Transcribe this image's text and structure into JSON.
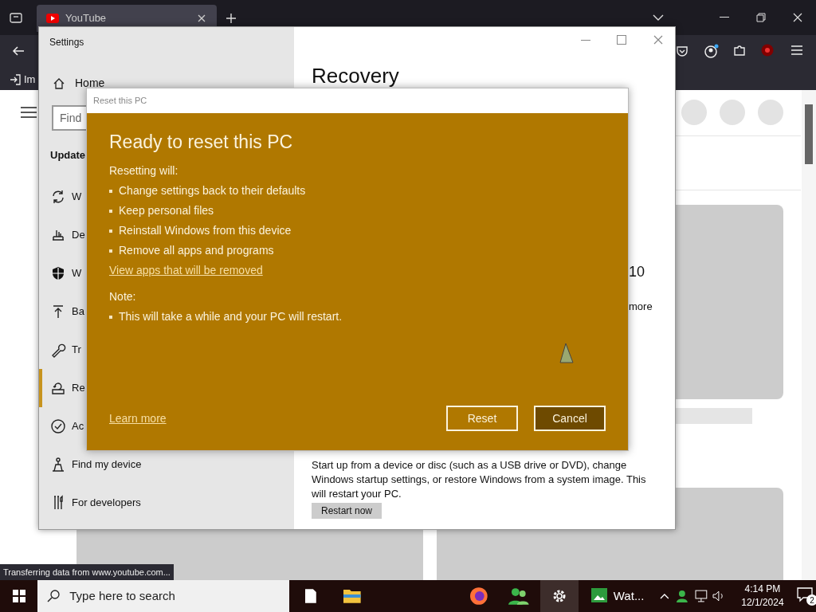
{
  "browser": {
    "tab": {
      "title": "YouTube"
    },
    "bookmark": "Im",
    "status": "Transferring data from www.youtube.com..."
  },
  "settings": {
    "title": "Settings",
    "home": "Home",
    "search": {
      "placeholder": "Find"
    },
    "section": "Update",
    "items": [
      {
        "label": "W",
        "selected": false
      },
      {
        "label": "De",
        "selected": false
      },
      {
        "label": "W",
        "selected": false
      },
      {
        "label": "Ba",
        "selected": false
      },
      {
        "label": "Tr",
        "selected": false
      },
      {
        "label": "Re",
        "selected": true
      },
      {
        "label": "Ac",
        "selected": false
      },
      {
        "label": "Find my device",
        "selected": false
      },
      {
        "label": "For developers",
        "selected": false
      }
    ],
    "content": {
      "heading": "Recovery",
      "fragment_1": "10",
      "fragment_2": "more",
      "paragraph": "Start up from a device or disc (such as a USB drive or DVD), change Windows startup settings, or restore Windows from a system image. This will restart your PC.",
      "button": "Restart now"
    }
  },
  "dialog": {
    "title": "Reset this PC",
    "heading": "Ready to reset this PC",
    "intro": "Resetting will:",
    "bullets": [
      "Change settings back to their defaults",
      "Keep personal files",
      "Reinstall Windows from this device",
      "Remove all apps and programs"
    ],
    "link": "View apps that will be removed",
    "note_label": "Note:",
    "note_bullets": [
      "This will take a while and your PC will restart."
    ],
    "learn_more": "Learn more",
    "buttons": [
      {
        "label": "Reset",
        "kind": "outline"
      },
      {
        "label": "Cancel",
        "kind": "filled"
      }
    ]
  },
  "taskbar": {
    "search": {
      "placeholder": "Type here to search"
    },
    "app": "Wat...",
    "time": "4:14 PM",
    "date": "12/1/2024",
    "notifications": "2"
  }
}
